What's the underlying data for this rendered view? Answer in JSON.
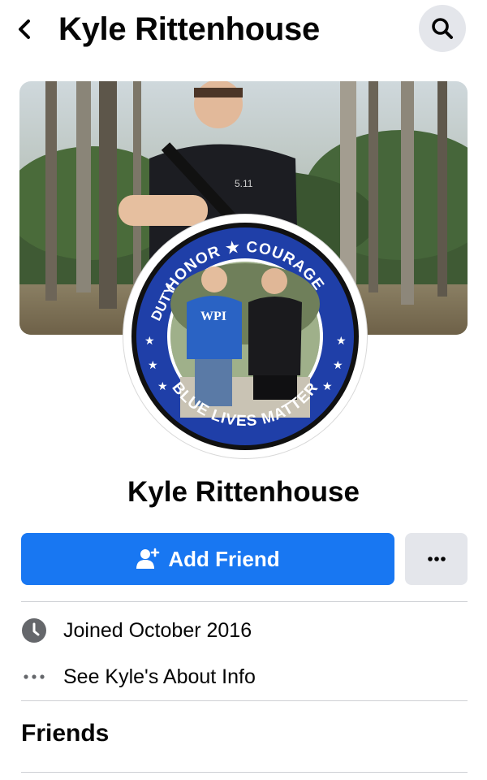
{
  "header": {
    "title": "Kyle Rittenhouse",
    "back_icon": "chevron-left-icon",
    "search_icon": "search-icon"
  },
  "cover": {
    "badge_label_1": "5.11"
  },
  "avatar": {
    "ring_top": "HONOR ★ COURAGE",
    "ring_left": "DUTY",
    "ring_bottom": "BLUE LIVES MATTER",
    "shirt_text": "WPI",
    "ring_color": "#1f3fa8"
  },
  "profile": {
    "name": "Kyle Rittenhouse"
  },
  "actions": {
    "add_friend_label": "Add Friend",
    "add_friend_icon": "add-person-icon",
    "more_icon": "more-horizontal-icon",
    "accent_color": "#1877f2"
  },
  "info": {
    "joined": "Joined October 2016",
    "joined_icon": "clock-icon",
    "about": "See Kyle's About Info",
    "about_icon": "more-horizontal-icon"
  },
  "friends": {
    "title": "Friends"
  }
}
